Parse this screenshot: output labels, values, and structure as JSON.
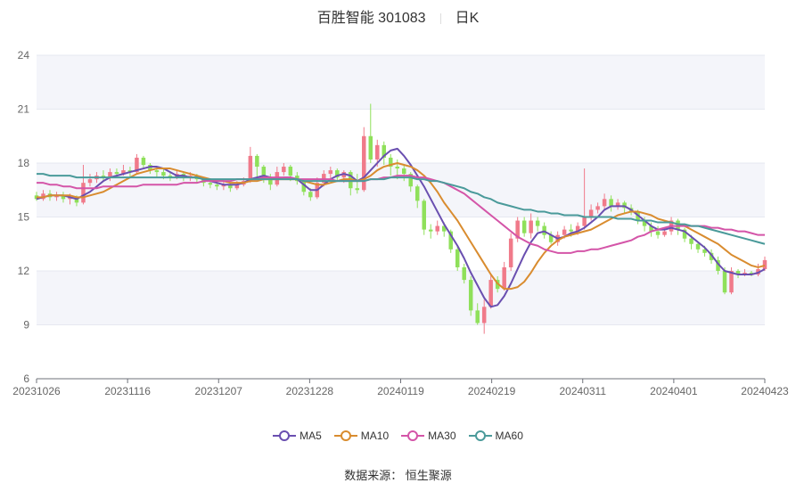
{
  "header": {
    "name": "百胜智能 301083",
    "period": "日K"
  },
  "source": "数据来源： 恒生聚源",
  "chart_data": {
    "type": "candlestick",
    "ylim": [
      6,
      24
    ],
    "yticks": [
      6,
      9,
      12,
      15,
      18,
      21,
      24
    ],
    "xticks": [
      "20231026",
      "20231116",
      "20231207",
      "20231228",
      "20240119",
      "20240219",
      "20240311",
      "20240401",
      "20240423"
    ],
    "up_color": "#f07a8a",
    "down_color": "#8fe05a",
    "candles": [
      [
        16.2,
        16.0,
        16.4,
        15.9
      ],
      [
        16.0,
        16.3,
        16.5,
        15.9
      ],
      [
        16.3,
        16.1,
        16.5,
        15.9
      ],
      [
        16.1,
        16.2,
        16.4,
        15.9
      ],
      [
        16.2,
        16.0,
        16.4,
        15.8
      ],
      [
        16.0,
        16.1,
        16.3,
        15.7
      ],
      [
        16.1,
        15.8,
        16.2,
        15.6
      ],
      [
        15.8,
        16.9,
        17.9,
        15.7
      ],
      [
        16.9,
        17.1,
        17.4,
        16.7
      ],
      [
        17.1,
        17.3,
        17.5,
        16.9
      ],
      [
        17.3,
        17.2,
        17.6,
        17.0
      ],
      [
        17.2,
        17.5,
        17.7,
        17.0
      ],
      [
        17.5,
        17.4,
        17.7,
        17.2
      ],
      [
        17.4,
        17.6,
        17.9,
        17.3
      ],
      [
        17.6,
        17.5,
        17.8,
        17.2
      ],
      [
        17.5,
        18.3,
        18.5,
        17.4
      ],
      [
        18.3,
        17.9,
        18.4,
        17.7
      ],
      [
        17.9,
        17.6,
        18.0,
        17.4
      ],
      [
        17.6,
        17.5,
        17.8,
        17.2
      ],
      [
        17.5,
        17.3,
        17.7,
        17.1
      ],
      [
        17.3,
        17.2,
        17.5,
        17.0
      ],
      [
        17.2,
        17.4,
        17.6,
        17.1
      ],
      [
        17.4,
        17.2,
        17.5,
        17.0
      ],
      [
        17.2,
        17.3,
        17.5,
        17.0
      ],
      [
        17.3,
        17.1,
        17.4,
        16.9
      ],
      [
        17.1,
        16.9,
        17.2,
        16.7
      ],
      [
        16.9,
        16.8,
        17.1,
        16.6
      ],
      [
        16.8,
        16.7,
        17.0,
        16.5
      ],
      [
        16.7,
        16.8,
        17.0,
        16.5
      ],
      [
        16.8,
        16.6,
        16.9,
        16.4
      ],
      [
        16.6,
        16.8,
        17.0,
        16.5
      ],
      [
        16.8,
        17.0,
        17.2,
        16.7
      ],
      [
        17.0,
        18.4,
        18.9,
        16.9
      ],
      [
        18.4,
        17.8,
        18.5,
        17.2
      ],
      [
        17.8,
        17.2,
        17.9,
        16.9
      ],
      [
        17.2,
        16.8,
        17.4,
        16.5
      ],
      [
        16.8,
        17.5,
        17.8,
        16.7
      ],
      [
        17.5,
        17.8,
        18.0,
        17.3
      ],
      [
        17.8,
        17.3,
        17.9,
        17.0
      ],
      [
        17.3,
        17.0,
        17.5,
        16.8
      ],
      [
        17.0,
        16.4,
        17.1,
        16.2
      ],
      [
        16.4,
        16.1,
        16.6,
        15.9
      ],
      [
        16.1,
        16.9,
        17.2,
        16.0
      ],
      [
        16.9,
        17.4,
        17.6,
        16.7
      ],
      [
        17.4,
        17.6,
        17.8,
        17.1
      ],
      [
        17.6,
        17.2,
        17.7,
        17.0
      ],
      [
        17.2,
        17.5,
        17.6,
        16.9
      ],
      [
        17.5,
        16.6,
        17.6,
        16.2
      ],
      [
        16.6,
        16.5,
        17.4,
        16.3
      ],
      [
        16.5,
        19.5,
        20.0,
        16.4
      ],
      [
        19.5,
        18.2,
        21.3,
        18.0
      ],
      [
        18.2,
        19.0,
        19.3,
        17.8
      ],
      [
        19.0,
        18.3,
        19.2,
        17.9
      ],
      [
        18.3,
        17.8,
        18.5,
        17.3
      ],
      [
        17.8,
        17.7,
        18.2,
        17.1
      ],
      [
        17.7,
        17.4,
        17.9,
        17.0
      ],
      [
        17.4,
        16.7,
        17.5,
        16.4
      ],
      [
        16.7,
        15.9,
        16.8,
        15.5
      ],
      [
        15.9,
        14.3,
        16.0,
        14.0
      ],
      [
        14.3,
        14.2,
        14.6,
        13.8
      ],
      [
        14.2,
        14.5,
        14.8,
        14.0
      ],
      [
        14.5,
        14.2,
        14.7,
        13.9
      ],
      [
        14.2,
        13.2,
        14.3,
        13.0
      ],
      [
        13.2,
        12.2,
        13.4,
        12.0
      ],
      [
        12.2,
        11.5,
        12.4,
        11.3
      ],
      [
        11.5,
        9.8,
        11.7,
        9.5
      ],
      [
        9.8,
        9.1,
        10.2,
        9.0
      ],
      [
        9.1,
        10.0,
        10.4,
        8.5
      ],
      [
        10.0,
        11.5,
        11.8,
        9.9
      ],
      [
        11.5,
        11.0,
        11.7,
        10.8
      ],
      [
        11.0,
        12.2,
        12.5,
        10.9
      ],
      [
        12.2,
        13.8,
        14.1,
        12.0
      ],
      [
        13.8,
        14.8,
        15.0,
        13.6
      ],
      [
        14.8,
        14.1,
        15.0,
        13.9
      ],
      [
        14.1,
        14.8,
        15.2,
        13.8
      ],
      [
        14.8,
        14.5,
        15.0,
        14.2
      ],
      [
        14.5,
        14.0,
        14.7,
        13.8
      ],
      [
        14.0,
        13.6,
        14.2,
        13.5
      ],
      [
        13.6,
        14.0,
        14.2,
        13.4
      ],
      [
        14.0,
        14.3,
        14.5,
        13.8
      ],
      [
        14.3,
        14.2,
        14.6,
        13.9
      ],
      [
        14.2,
        14.5,
        14.7,
        14.0
      ],
      [
        14.5,
        15.0,
        17.7,
        14.3
      ],
      [
        15.0,
        15.4,
        15.7,
        14.8
      ],
      [
        15.4,
        15.6,
        15.8,
        15.2
      ],
      [
        15.6,
        16.0,
        16.3,
        15.4
      ],
      [
        16.0,
        15.6,
        16.2,
        15.3
      ],
      [
        15.6,
        15.8,
        16.0,
        15.4
      ],
      [
        15.8,
        15.5,
        15.9,
        15.2
      ],
      [
        15.5,
        15.3,
        15.7,
        15.1
      ],
      [
        15.3,
        14.8,
        15.4,
        14.6
      ],
      [
        14.8,
        14.5,
        15.0,
        14.2
      ],
      [
        14.5,
        14.2,
        14.7,
        13.9
      ],
      [
        14.2,
        14.0,
        14.5,
        13.8
      ],
      [
        14.0,
        14.2,
        14.4,
        13.9
      ],
      [
        14.2,
        14.8,
        15.0,
        14.0
      ],
      [
        14.8,
        14.3,
        14.9,
        14.0
      ],
      [
        14.3,
        13.8,
        14.4,
        13.6
      ],
      [
        13.8,
        13.5,
        14.0,
        13.2
      ],
      [
        13.5,
        13.2,
        13.6,
        13.0
      ],
      [
        13.2,
        13.0,
        13.4,
        12.8
      ],
      [
        13.0,
        12.6,
        13.2,
        12.4
      ],
      [
        12.6,
        12.0,
        12.8,
        11.8
      ],
      [
        12.0,
        10.8,
        12.2,
        10.7
      ],
      [
        10.8,
        12.0,
        12.2,
        10.7
      ],
      [
        12.0,
        11.8,
        12.1,
        11.6
      ],
      [
        11.8,
        11.9,
        12.1,
        11.7
      ],
      [
        11.9,
        11.8,
        12.0,
        11.7
      ],
      [
        11.8,
        12.1,
        12.4,
        11.7
      ],
      [
        12.1,
        12.6,
        12.8,
        12.0
      ]
    ],
    "series": [
      {
        "name": "MA5",
        "color": "#6a4fb0",
        "values": [
          16.0,
          16.1,
          16.2,
          16.2,
          16.2,
          16.1,
          16.0,
          16.2,
          16.4,
          16.7,
          17.0,
          17.2,
          17.3,
          17.4,
          17.5,
          17.6,
          17.7,
          17.8,
          17.8,
          17.7,
          17.5,
          17.3,
          17.3,
          17.2,
          17.2,
          17.1,
          17.0,
          16.9,
          16.8,
          16.8,
          16.8,
          16.9,
          17.1,
          17.2,
          17.3,
          17.2,
          17.1,
          17.2,
          17.2,
          17.1,
          16.8,
          16.5,
          16.5,
          16.8,
          17.1,
          17.3,
          17.4,
          17.3,
          17.0,
          17.2,
          17.6,
          18.0,
          18.4,
          18.7,
          18.8,
          18.4,
          17.9,
          17.3,
          16.7,
          16.0,
          15.3,
          14.6,
          14.0,
          13.4,
          12.7,
          11.9,
          11.2,
          10.5,
          10.0,
          10.1,
          10.6,
          11.3,
          12.1,
          12.9,
          13.6,
          14.1,
          14.2,
          14.0,
          13.8,
          13.9,
          14.1,
          14.2,
          14.4,
          14.7,
          15.0,
          15.4,
          15.6,
          15.6,
          15.6,
          15.4,
          15.1,
          14.8,
          14.5,
          14.3,
          14.3,
          14.4,
          14.3,
          14.2,
          13.9,
          13.6,
          13.3,
          12.9,
          12.4,
          12.0,
          11.9,
          11.8,
          11.8,
          11.8,
          11.9,
          12.1
        ]
      },
      {
        "name": "MA10",
        "color": "#d98c2f",
        "values": [
          16.1,
          16.1,
          16.2,
          16.2,
          16.2,
          16.2,
          16.1,
          16.1,
          16.2,
          16.3,
          16.4,
          16.6,
          16.8,
          17.0,
          17.2,
          17.4,
          17.5,
          17.6,
          17.7,
          17.7,
          17.7,
          17.6,
          17.5,
          17.4,
          17.3,
          17.2,
          17.1,
          17.0,
          17.0,
          16.9,
          16.9,
          16.9,
          17.0,
          17.0,
          17.1,
          17.1,
          17.1,
          17.1,
          17.1,
          17.1,
          17.0,
          16.9,
          16.8,
          16.8,
          16.9,
          17.0,
          17.1,
          17.1,
          17.0,
          17.1,
          17.3,
          17.6,
          17.8,
          17.9,
          18.0,
          17.9,
          17.8,
          17.6,
          17.3,
          16.9,
          16.4,
          15.8,
          15.3,
          14.8,
          14.2,
          13.6,
          13.0,
          12.4,
          11.8,
          11.3,
          11.0,
          11.0,
          11.1,
          11.4,
          11.9,
          12.5,
          13.0,
          13.4,
          13.7,
          13.9,
          14.0,
          14.1,
          14.2,
          14.3,
          14.5,
          14.7,
          14.9,
          15.1,
          15.2,
          15.3,
          15.3,
          15.2,
          15.1,
          14.9,
          14.8,
          14.7,
          14.6,
          14.5,
          14.3,
          14.1,
          13.9,
          13.7,
          13.5,
          13.2,
          12.9,
          12.7,
          12.5,
          12.3,
          12.2,
          12.3
        ]
      },
      {
        "name": "MA30",
        "color": "#d455a8",
        "values": [
          16.9,
          16.9,
          16.8,
          16.8,
          16.7,
          16.7,
          16.6,
          16.6,
          16.6,
          16.6,
          16.7,
          16.7,
          16.7,
          16.7,
          16.7,
          16.7,
          16.8,
          16.8,
          16.8,
          16.8,
          16.8,
          16.8,
          16.9,
          16.9,
          16.9,
          17.0,
          17.0,
          17.0,
          17.0,
          17.0,
          17.1,
          17.1,
          17.1,
          17.1,
          17.2,
          17.2,
          17.2,
          17.2,
          17.2,
          17.1,
          17.1,
          17.1,
          17.1,
          17.1,
          17.1,
          17.0,
          17.0,
          17.0,
          17.0,
          17.0,
          17.1,
          17.1,
          17.2,
          17.2,
          17.3,
          17.3,
          17.3,
          17.2,
          17.2,
          17.1,
          17.0,
          16.9,
          16.7,
          16.5,
          16.3,
          16.0,
          15.7,
          15.4,
          15.1,
          14.8,
          14.5,
          14.2,
          13.9,
          13.7,
          13.5,
          13.4,
          13.2,
          13.1,
          13.0,
          13.0,
          13.0,
          13.1,
          13.1,
          13.2,
          13.2,
          13.3,
          13.4,
          13.5,
          13.6,
          13.7,
          13.9,
          14.0,
          14.2,
          14.3,
          14.4,
          14.5,
          14.5,
          14.5,
          14.5,
          14.5,
          14.5,
          14.4,
          14.4,
          14.3,
          14.3,
          14.2,
          14.2,
          14.1,
          14.0,
          14.0
        ]
      },
      {
        "name": "MA60",
        "color": "#4a9a9a",
        "values": [
          17.4,
          17.4,
          17.3,
          17.3,
          17.3,
          17.3,
          17.2,
          17.2,
          17.2,
          17.2,
          17.2,
          17.2,
          17.2,
          17.2,
          17.2,
          17.2,
          17.2,
          17.2,
          17.2,
          17.2,
          17.2,
          17.2,
          17.2,
          17.2,
          17.2,
          17.1,
          17.1,
          17.1,
          17.1,
          17.1,
          17.1,
          17.1,
          17.1,
          17.1,
          17.1,
          17.1,
          17.1,
          17.1,
          17.1,
          17.1,
          17.0,
          17.0,
          17.0,
          17.0,
          17.0,
          17.0,
          17.0,
          17.0,
          17.0,
          17.0,
          17.1,
          17.1,
          17.1,
          17.2,
          17.2,
          17.2,
          17.2,
          17.1,
          17.1,
          17.0,
          17.0,
          16.9,
          16.8,
          16.7,
          16.6,
          16.4,
          16.3,
          16.1,
          16.0,
          15.8,
          15.7,
          15.6,
          15.5,
          15.4,
          15.4,
          15.3,
          15.3,
          15.2,
          15.2,
          15.1,
          15.1,
          15.1,
          15.0,
          15.0,
          15.0,
          15.0,
          15.0,
          14.9,
          14.9,
          14.9,
          14.8,
          14.8,
          14.8,
          14.7,
          14.7,
          14.7,
          14.6,
          14.6,
          14.5,
          14.5,
          14.4,
          14.3,
          14.2,
          14.1,
          14.0,
          13.9,
          13.8,
          13.7,
          13.6,
          13.5
        ]
      }
    ]
  }
}
